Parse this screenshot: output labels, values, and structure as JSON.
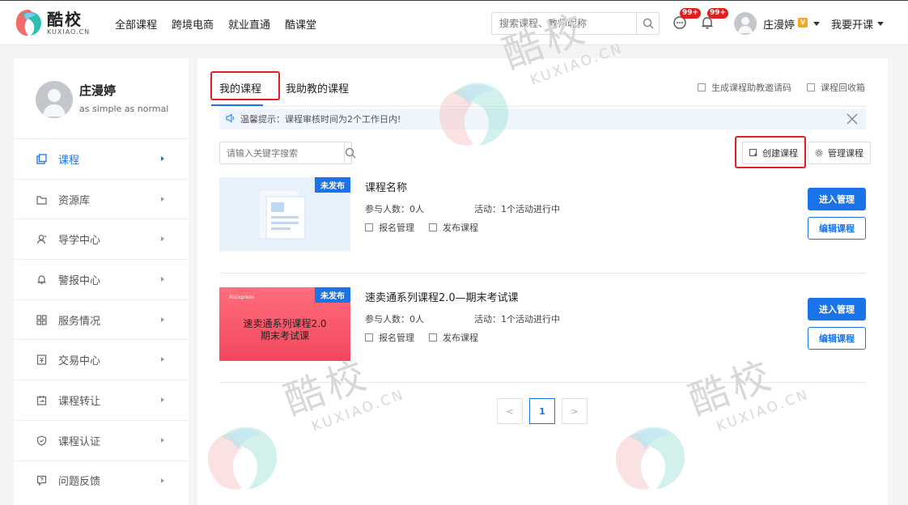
{
  "header": {
    "logo_cn": "酷校",
    "logo_en": "KUXIAO.CN",
    "nav": [
      "全部课程",
      "跨境电商",
      "就业直通",
      "酷课堂"
    ],
    "search_placeholder": "搜索课程、教师昵称",
    "message_badge": "99+",
    "notification_badge": "99+",
    "user_name": "庄漫婷",
    "open_course": "我要开课"
  },
  "sidebar": {
    "name": "庄漫婷",
    "motto": "as simple as normal",
    "items": [
      {
        "label": "课程",
        "icon": "course-icon",
        "active": true
      },
      {
        "label": "资源库",
        "icon": "resource-icon"
      },
      {
        "label": "导学中心",
        "icon": "guide-icon"
      },
      {
        "label": "警报中心",
        "icon": "bell-icon"
      },
      {
        "label": "服务情况",
        "icon": "grid-icon"
      },
      {
        "label": "交易中心",
        "icon": "trade-icon"
      },
      {
        "label": "课程转让",
        "icon": "transfer-icon"
      },
      {
        "label": "课程认证",
        "icon": "shield-icon"
      },
      {
        "label": "问题反馈",
        "icon": "feedback-icon"
      }
    ]
  },
  "main": {
    "tabs": [
      "我的课程",
      "我助教的课程"
    ],
    "links": [
      "生成课程助教邀请码",
      "课程回收箱"
    ],
    "notice": "温馨提示：课程审核时间为2个工作日内!",
    "keyword_placeholder": "请输入关键字搜索",
    "create_button": "创建课程",
    "manage_button": "管理课程",
    "courses": [
      {
        "title": "课程名称",
        "status": "未发布",
        "participants": "参与人数：0人",
        "activity": "活动：1个活动进行中",
        "enroll": "报名管理",
        "publish": "发布课程",
        "enter": "进入管理",
        "edit": "编辑课程"
      },
      {
        "title": "速卖通系列课程2.0—期末考试课",
        "status": "未发布",
        "thumb_brand": "AliExpress",
        "thumb_line1": "速卖通系列课程2.0",
        "thumb_line2": "期末考试课",
        "participants": "参与人数：0人",
        "activity": "活动：1个活动进行中",
        "enroll": "报名管理",
        "publish": "发布课程",
        "enter": "进入管理",
        "edit": "编辑课程"
      }
    ],
    "pager": {
      "prev": "<",
      "current": "1",
      "next": ">"
    }
  },
  "watermark": {
    "cn": "酷校",
    "en": "KUXIAO.CN"
  },
  "colors": {
    "accent": "#1a73e8",
    "highlight": "#e02020",
    "badge": "#e02020"
  }
}
